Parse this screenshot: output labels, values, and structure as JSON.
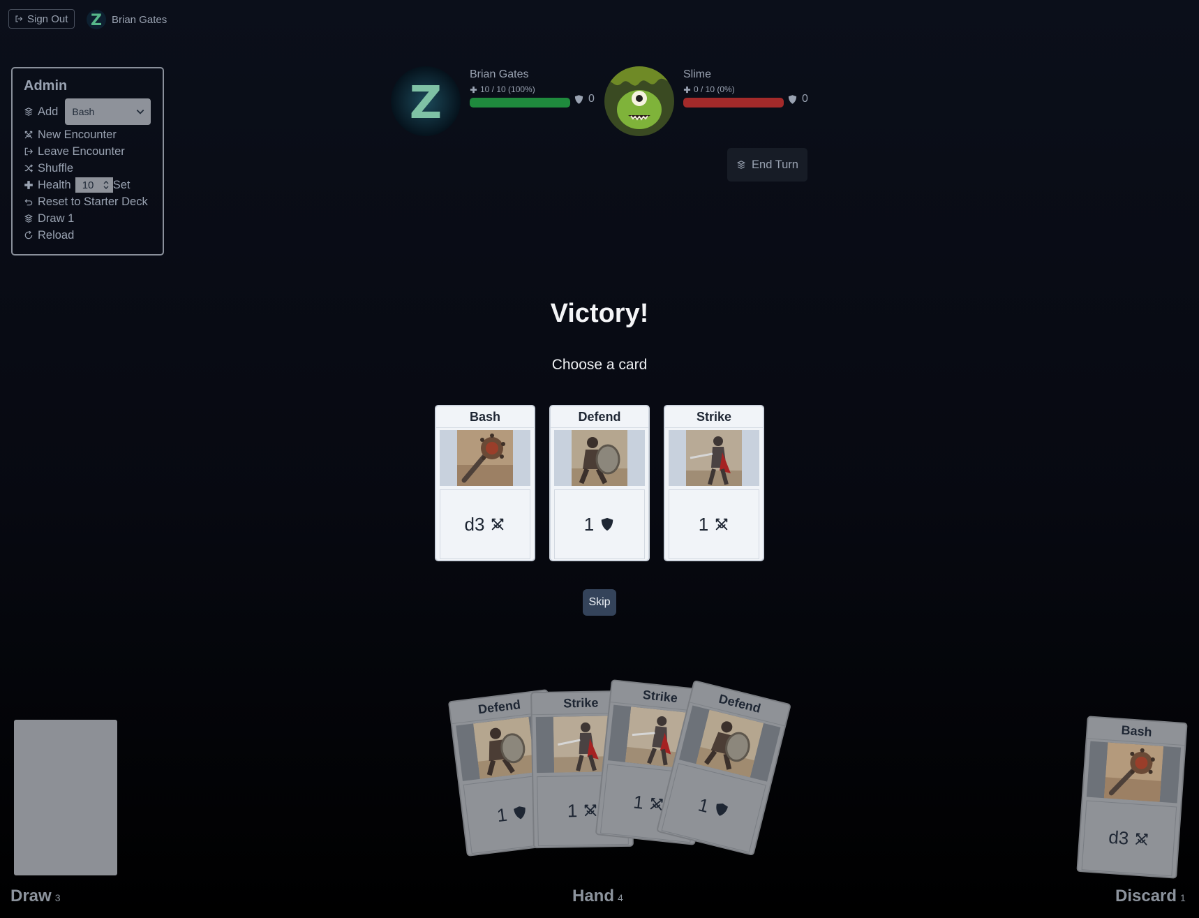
{
  "topbar": {
    "sign_out_label": "Sign Out",
    "user_name": "Brian Gates"
  },
  "admin": {
    "title": "Admin",
    "add_label": "Add",
    "add_select_value": "Bash",
    "new_encounter": "New Encounter",
    "leave_encounter": "Leave Encounter",
    "shuffle": "Shuffle",
    "health_label": "Health",
    "health_value": "10",
    "set_label": "Set",
    "reset_deck": "Reset to Starter Deck",
    "draw_one": "Draw 1",
    "reload": "Reload"
  },
  "player": {
    "name": "Brian Gates",
    "hp_text": "10 / 10 (100%)",
    "hp_fraction": 1.0,
    "block": "0",
    "bar_color": "#1f8a3d"
  },
  "enemy": {
    "name": "Slime",
    "hp_text": "0 / 10 (0%)",
    "hp_fraction": 0.0,
    "block": "0",
    "bar_color": "#a32a2a"
  },
  "end_turn_label": "End Turn",
  "reward": {
    "title": "Victory!",
    "subtitle": "Choose a card",
    "skip_label": "Skip",
    "cards": [
      {
        "title": "Bash",
        "value": "d3",
        "icon": "swords-icon"
      },
      {
        "title": "Defend",
        "value": "1",
        "icon": "shield-icon"
      },
      {
        "title": "Strike",
        "value": "1",
        "icon": "swords-icon"
      }
    ]
  },
  "hand": {
    "label": "Hand",
    "count": "4",
    "cards": [
      {
        "title": "Defend",
        "value": "1",
        "icon": "shield-icon"
      },
      {
        "title": "Strike",
        "value": "1",
        "icon": "swords-icon"
      },
      {
        "title": "Strike",
        "value": "1",
        "icon": "swords-icon"
      },
      {
        "title": "Defend",
        "value": "1",
        "icon": "shield-icon"
      }
    ]
  },
  "draw_pile": {
    "label": "Draw",
    "count": "3"
  },
  "discard_pile": {
    "label": "Discard",
    "count": "1",
    "top_card": {
      "title": "Bash",
      "value": "d3",
      "icon": "swords-icon"
    }
  }
}
